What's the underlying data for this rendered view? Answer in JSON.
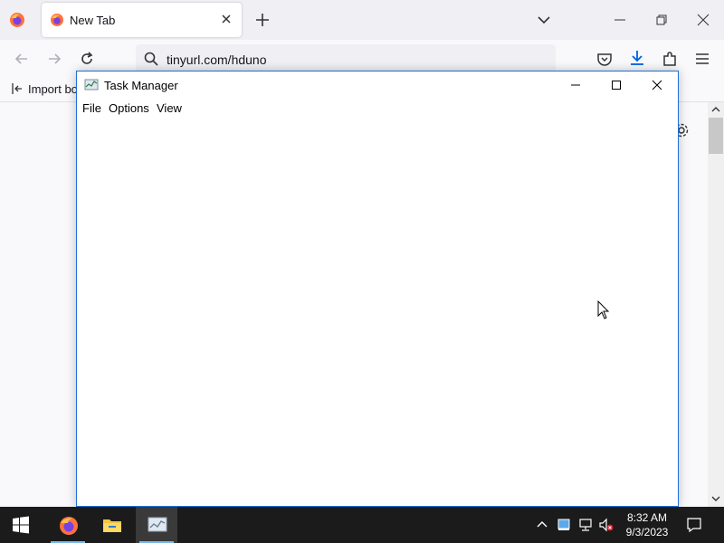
{
  "browser": {
    "tab": {
      "title": "New Tab"
    },
    "url": "tinyurl.com/hduno",
    "bookmarks_bar": {
      "import_label": "Import bo"
    }
  },
  "task_manager": {
    "title": "Task Manager",
    "menu": [
      "File",
      "Options",
      "View"
    ]
  },
  "taskbar": {
    "time": "8:32 AM",
    "date": "9/3/2023",
    "icons": [
      "windows-start-icon",
      "firefox-icon",
      "file-explorer-icon",
      "task-manager-icon"
    ]
  },
  "colors": {
    "window_border": "#1e6fd9",
    "taskbar": "#1b1b1b",
    "taskbar_active_indicator": "#76b9ed",
    "firefox_orange": "#ff7139"
  }
}
